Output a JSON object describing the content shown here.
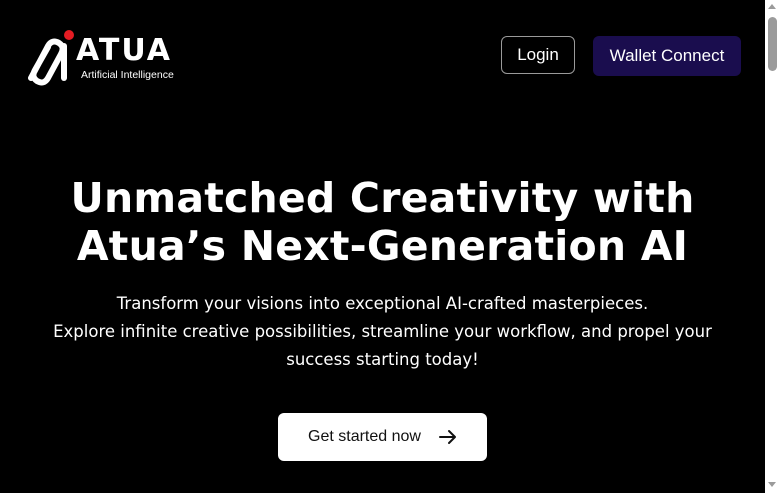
{
  "header": {
    "logo": {
      "wordmark": "ATUA",
      "tagline": "Artificial Intelligence",
      "icon": "atua-logo-icon",
      "accent_color": "#e51c23"
    },
    "login_label": "Login",
    "wallet_label": "Wallet Connect",
    "wallet_color": "#1a0d4e"
  },
  "hero": {
    "title_line1": "Unmatched Creativity with",
    "title_line2": "Atua’s Next-Generation AI",
    "subtitle_line1": "Transform your visions into exceptional AI-crafted masterpieces.",
    "subtitle_line2": "Explore infinite creative possibilities, streamline your workflow, and propel your success starting today!",
    "cta_label": "Get started now",
    "cta_icon": "arrow-right-icon"
  },
  "colors": {
    "background": "#000000",
    "text": "#ffffff"
  }
}
